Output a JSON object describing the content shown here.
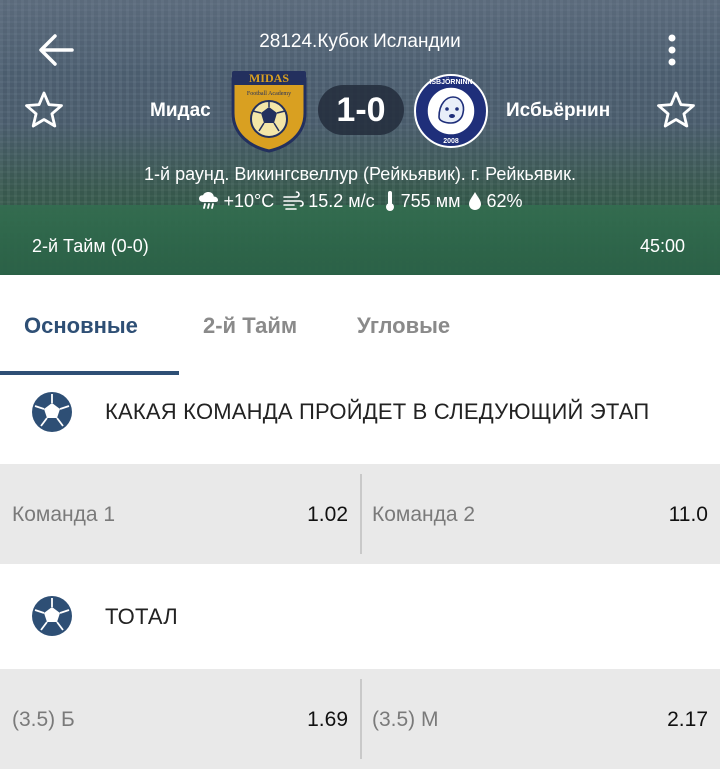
{
  "header": {
    "tournament": "28124.Кубок Исландии",
    "team1": {
      "name": "Мидас",
      "logo_text": "MIDAS",
      "logo_sub": "Football Academy"
    },
    "team2": {
      "name": "Исбьёрнин",
      "logo_text": "ISBJÖRNINN",
      "logo_year": "2008"
    },
    "score": "1-0",
    "round_info": "1-й раунд. Викингсвеллур (Рейкьявик). г. Рейкьявик.",
    "weather": {
      "temperature": "+10°C",
      "wind": "15.2 м/с",
      "pressure": "755 мм",
      "humidity": "62%"
    },
    "period": "2-й  Тайм (0-0)",
    "clock": "45:00",
    "icons": [
      "back-arrow-icon",
      "more-vert-icon",
      "star-outline-icon",
      "cloud-rain-icon",
      "wind-icon",
      "thermometer-icon",
      "drop-icon"
    ]
  },
  "tabs": [
    {
      "label": "Основные",
      "active": true
    },
    {
      "label": "2-й  Тайм",
      "active": false
    },
    {
      "label": "Угловые",
      "active": false
    }
  ],
  "markets": [
    {
      "title": "КАКАЯ КОМАНДА ПРОЙДЕТ В СЛЕДУЮЩИЙ ЭТАП",
      "icon": "soccer-ball-icon",
      "outcomes": [
        {
          "label": "Команда 1",
          "odds": "1.02"
        },
        {
          "label": "Команда 2",
          "odds": "11.0"
        }
      ]
    },
    {
      "title": "ТОТАЛ",
      "icon": "soccer-ball-icon",
      "outcomes": [
        {
          "label": "(3.5) Б",
          "odds": "1.69"
        },
        {
          "label": "(3.5) М",
          "odds": "2.17"
        }
      ]
    }
  ],
  "colors": {
    "accent": "#2e4f75",
    "odds_row_bg": "#e9e9e9",
    "logo1_gold": "#d9a021",
    "logo1_navy": "#23305e",
    "logo2_navy": "#1f2f7a"
  }
}
